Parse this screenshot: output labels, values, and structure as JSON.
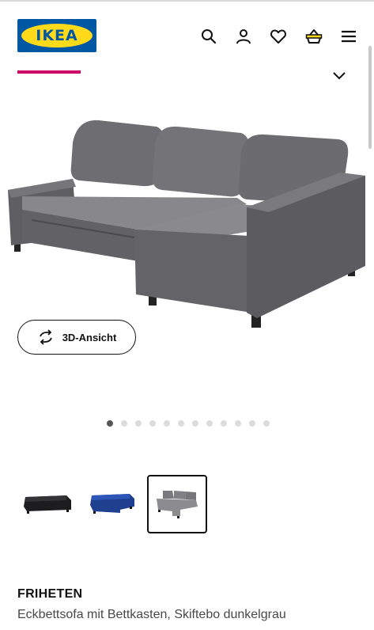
{
  "header": {
    "logo_text": "IKEA",
    "icons": [
      "search-icon",
      "user-icon",
      "heart-icon",
      "basket-icon",
      "menu-icon"
    ]
  },
  "product_gallery": {
    "view_3d_label": "3D-Ansicht",
    "dots_count": 12,
    "active_dot": 0,
    "thumbnails": [
      {
        "name": "black-sofa",
        "selected": false
      },
      {
        "name": "blue-sofa",
        "selected": false
      },
      {
        "name": "grey-sofa",
        "selected": true
      }
    ]
  },
  "product": {
    "name": "FRIHETEN",
    "description": "Eckbettsofa mit Bettkasten, Skiftebo dunkelgrau"
  },
  "colors": {
    "brand_blue": "#0058a3",
    "brand_yellow": "#ffda1a",
    "accent_pink": "#cc0066"
  }
}
